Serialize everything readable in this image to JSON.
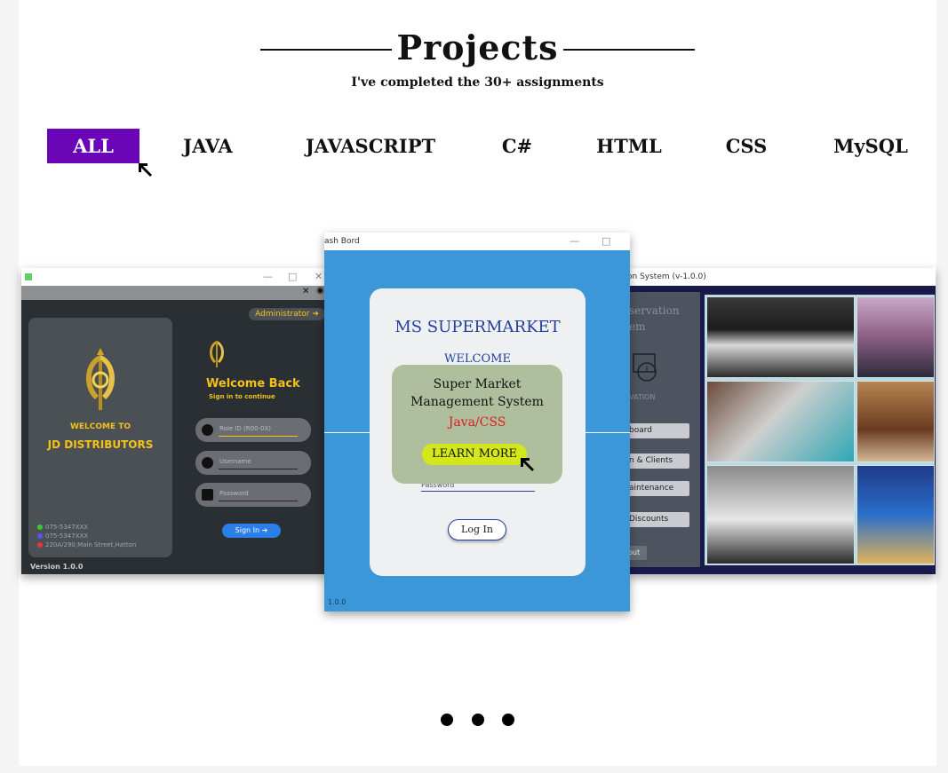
{
  "section": {
    "title": "Projects",
    "subtitle": "I've completed the 30+ assignments"
  },
  "filters": [
    {
      "label": "ALL",
      "active": true
    },
    {
      "label": "JAVA"
    },
    {
      "label": "JAVASCRIPT"
    },
    {
      "label": "C#"
    },
    {
      "label": "HTML"
    },
    {
      "label": "CSS"
    },
    {
      "label": "MySQL"
    }
  ],
  "slides": {
    "left": {
      "title_icon": "app-icon",
      "welcome_line1": "WELCOME TO",
      "welcome_line2": "JD DISTRIBUTORS",
      "admin_label": "Administrator",
      "welcome_back": "Welcome Back",
      "sign_in_to_continue": "Sign in to continue",
      "role_placeholder": "Role ID (R00-0X)",
      "username_placeholder": "Username",
      "password_placeholder": "Password",
      "sign_in_label": "Sign In",
      "contact_phone1": "075-5347XXX",
      "contact_phone2": "075-5347XXX",
      "contact_address": "220A/290,Main Street,Hatton",
      "version": "Version 1.0.0"
    },
    "center": {
      "window_title": "ash Bord",
      "app_title": "MS SUPERMARKET",
      "welcome": "WELCOME",
      "password_label": "Password",
      "login_label": "Log In",
      "version": "1.0.0"
    },
    "right": {
      "window_title": "on System (v-1.0.0)",
      "side_text1": "servation",
      "side_text2": "em",
      "side_text3": "VATION",
      "menu": [
        "board",
        "n & Clients",
        "aintenance",
        "Discounts"
      ],
      "logout": "out"
    }
  },
  "overlay": {
    "title": "Super Market Management System",
    "tech": "Java/CSS",
    "button": "LEARN MORE"
  },
  "carousel": {
    "dot_count": 3,
    "active_index": 1
  },
  "colors": {
    "active_filter": "#6a06b8",
    "center_bg": "#3b97d8",
    "overlay_bg": "#afbf9e",
    "learn_more_bg": "#d3e81a",
    "tech_text": "#d81e1e",
    "gold": "#f2c21b"
  }
}
